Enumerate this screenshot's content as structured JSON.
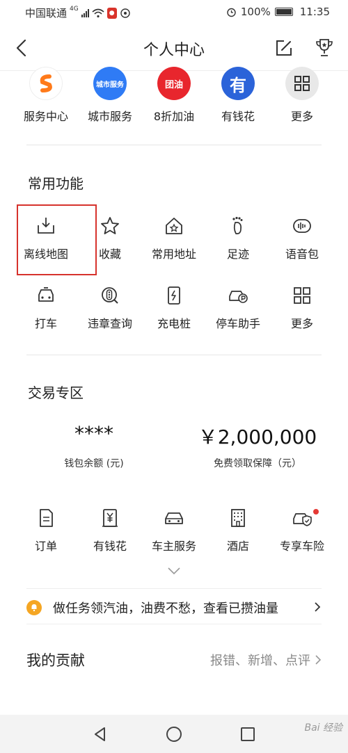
{
  "status_bar": {
    "carrier": "中国联通",
    "network": "4G",
    "battery": "100%",
    "time": "11:35"
  },
  "header": {
    "title": "个人中心"
  },
  "services": [
    {
      "label": "服务中心",
      "icon": "service-center-icon",
      "color": "#ff7a1a",
      "badge": ""
    },
    {
      "label": "城市服务",
      "icon": "city-service-icon",
      "color": "#2f7bf5",
      "badge": "城市服务"
    },
    {
      "label": "8折加油",
      "icon": "fuel-icon",
      "color": "#e8262d",
      "badge": "团油"
    },
    {
      "label": "有钱花",
      "icon": "loan-icon",
      "color": "#2b63d9",
      "badge": "有"
    },
    {
      "label": "更多",
      "icon": "more-grid-icon",
      "color": "#e8e8e8",
      "badge": ""
    }
  ],
  "common_functions": {
    "title": "常用功能",
    "row1": [
      {
        "label": "离线地图",
        "icon": "offline-map-icon"
      },
      {
        "label": "收藏",
        "icon": "star-icon"
      },
      {
        "label": "常用地址",
        "icon": "home-star-icon"
      },
      {
        "label": "足迹",
        "icon": "footprint-icon"
      },
      {
        "label": "语音包",
        "icon": "voice-pack-icon"
      }
    ],
    "row2": [
      {
        "label": "打车",
        "icon": "taxi-icon"
      },
      {
        "label": "违章查询",
        "icon": "traffic-violation-icon"
      },
      {
        "label": "充电桩",
        "icon": "charging-pile-icon"
      },
      {
        "label": "停车助手",
        "icon": "parking-icon"
      },
      {
        "label": "更多",
        "icon": "more-grid-icon"
      }
    ]
  },
  "trade_zone": {
    "title": "交易专区",
    "wallet_value": "****",
    "wallet_label": "钱包余额 (元)",
    "guarantee_value": "￥2,000,000",
    "guarantee_label": "免费领取保障（元）",
    "items": [
      {
        "label": "订单",
        "icon": "order-icon"
      },
      {
        "label": "有钱花",
        "icon": "yen-icon"
      },
      {
        "label": "车主服务",
        "icon": "car-icon"
      },
      {
        "label": "酒店",
        "icon": "hotel-icon"
      },
      {
        "label": "专享车险",
        "icon": "car-insurance-icon"
      }
    ]
  },
  "task_banner": {
    "text": "做任务领汽油，油费不愁，查看已攒油量"
  },
  "contribution": {
    "title": "我的贡献",
    "links": "报错、新增、点评"
  },
  "watermark": "Bai 经验"
}
